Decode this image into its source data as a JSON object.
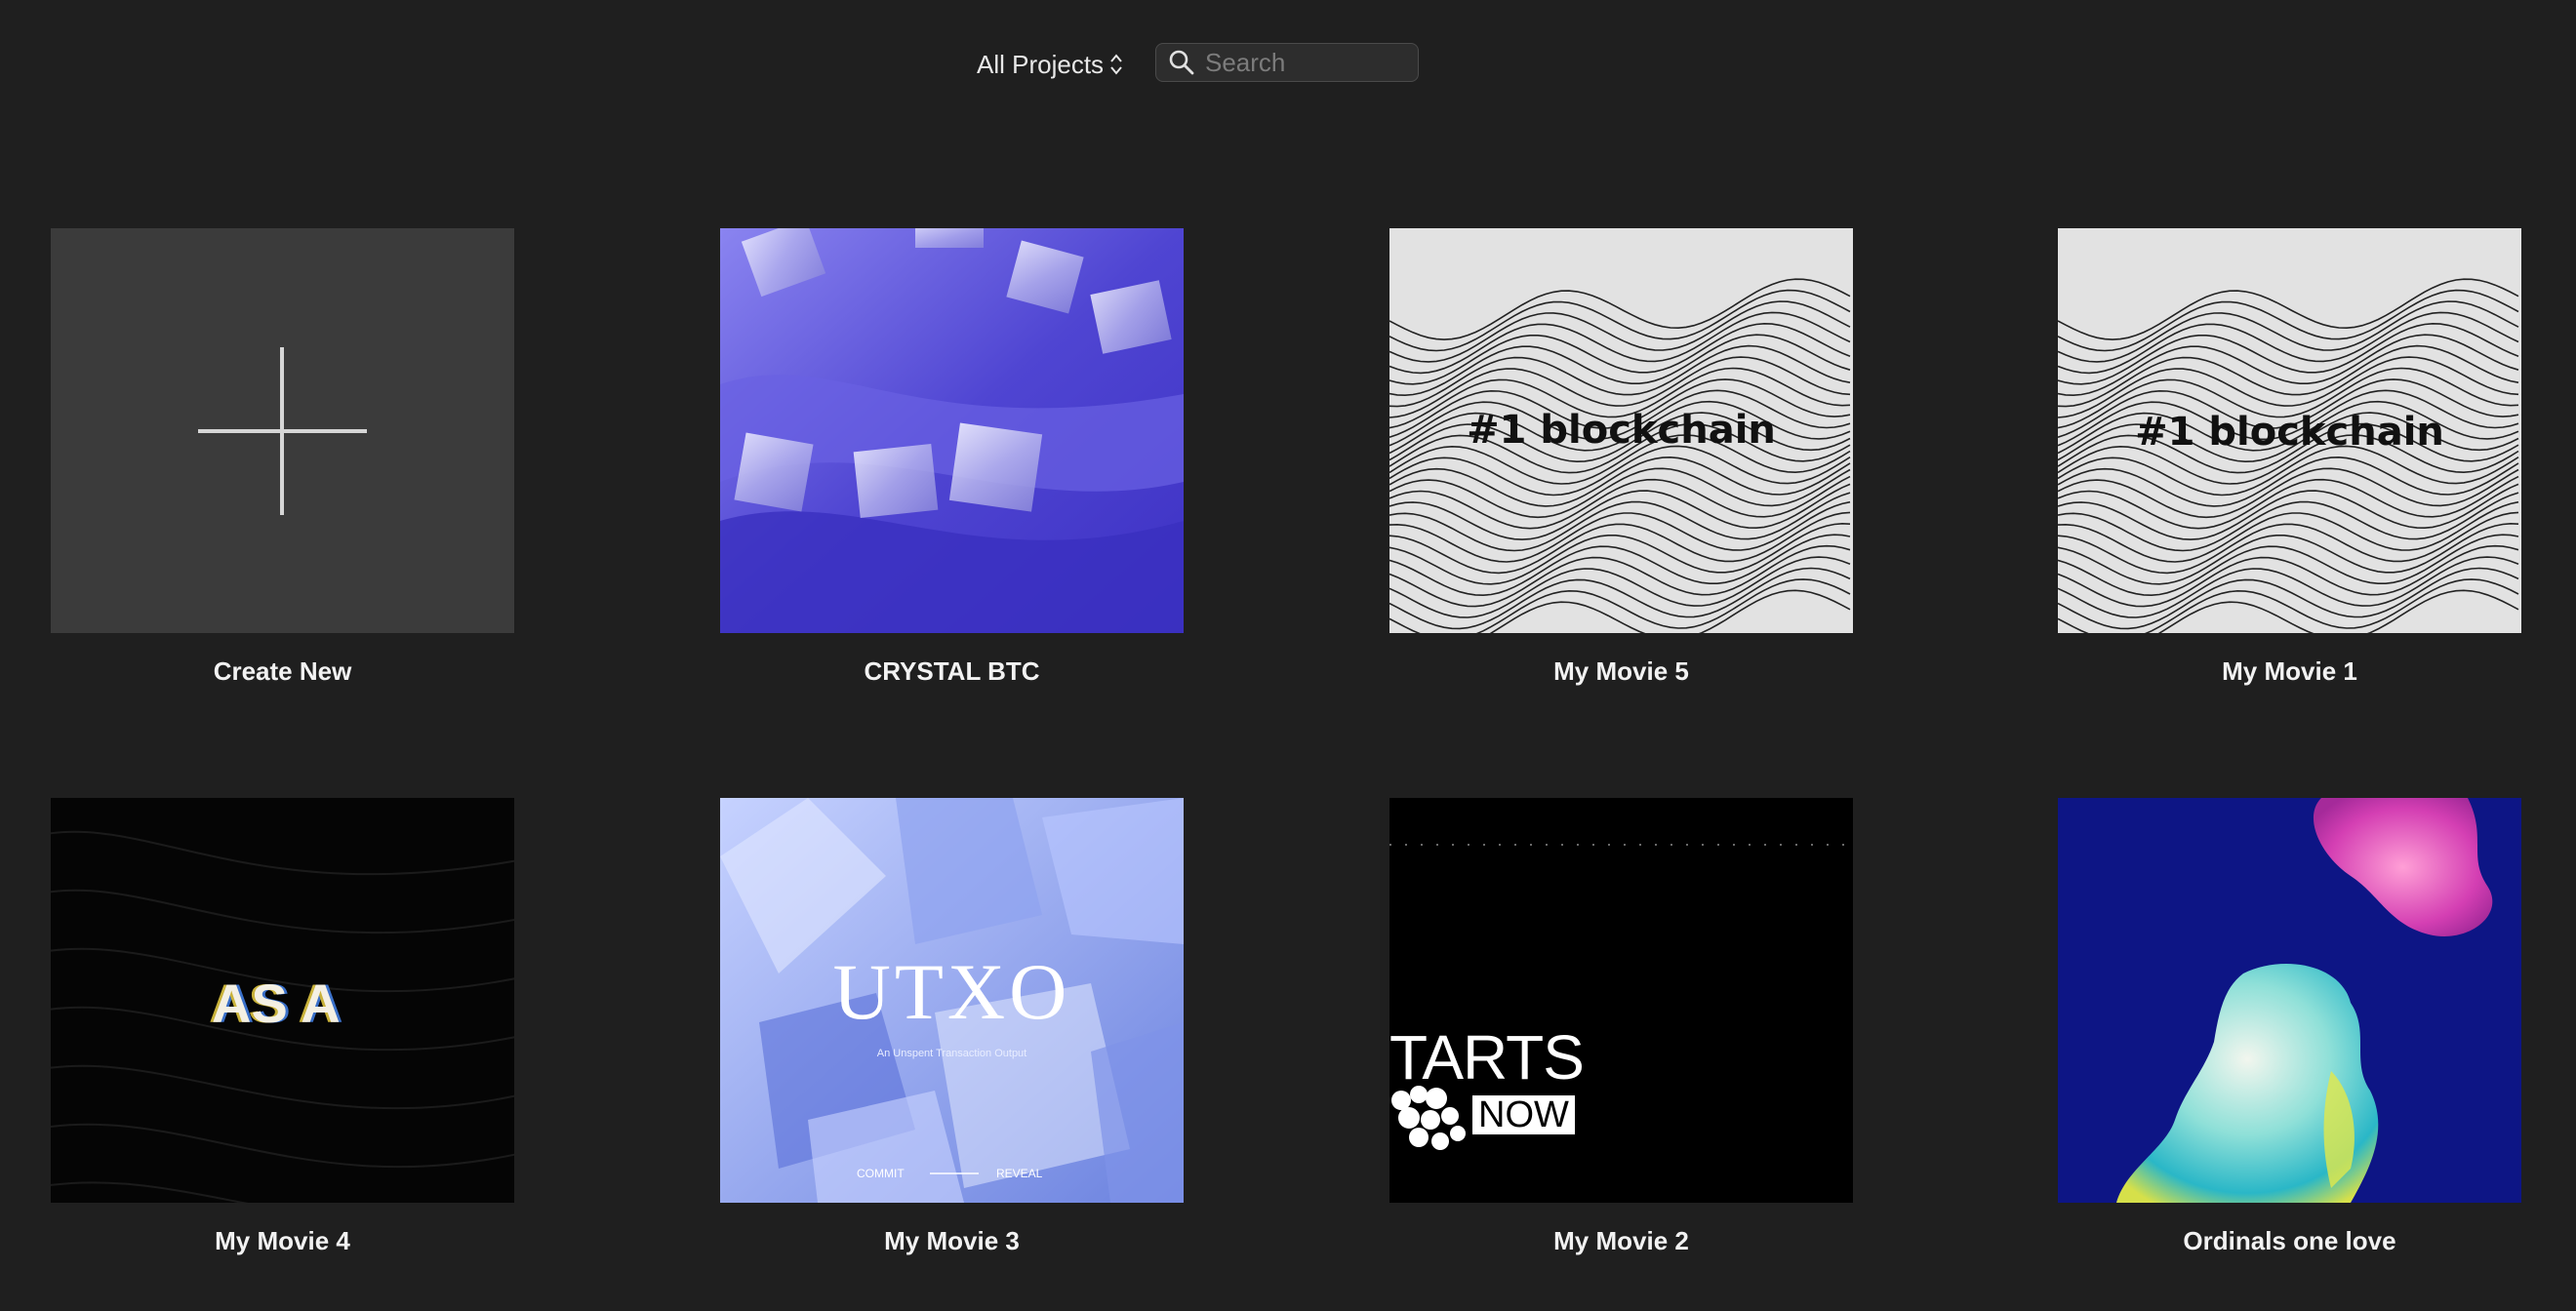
{
  "toolbar": {
    "project_filter": "All Projects",
    "search_placeholder": "Search"
  },
  "projects": [
    {
      "title": "Create New"
    },
    {
      "title": "CRYSTAL BTC"
    },
    {
      "title": "My Movie 5",
      "overlay": "#1 blockchain"
    },
    {
      "title": "My Movie 1",
      "overlay": "#1 blockchain"
    },
    {
      "title": "My Movie 4",
      "overlay": "AS A"
    },
    {
      "title": "My Movie 3",
      "overlay": "UTXO",
      "subtitle": "An Unspent Transaction Output",
      "left_caption": "COMMIT",
      "right_caption": "REVEAL"
    },
    {
      "title": "My Movie 2",
      "overlay": "TARTS",
      "badge": "NOW"
    },
    {
      "title": "Ordinals one love"
    }
  ],
  "colors": {
    "background": "#1f1f1f",
    "create_tile": "#3b3b3b",
    "crystal_purple": "#5b52d9",
    "ordinals_blue": "#0d1585"
  }
}
